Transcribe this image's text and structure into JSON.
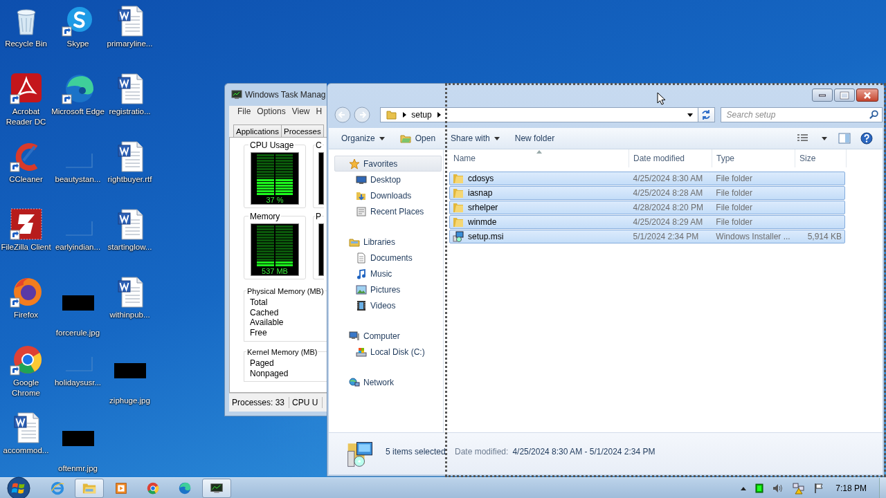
{
  "desktop": {
    "icons": [
      {
        "label": "Recycle Bin",
        "kind": "recycle",
        "shortcut": false
      },
      {
        "label": "Acrobat Reader DC",
        "kind": "acrobat",
        "shortcut": true
      },
      {
        "label": "CCleaner",
        "kind": "ccleaner",
        "shortcut": true
      },
      {
        "label": "FileZilla Client",
        "kind": "filezilla",
        "shortcut": true
      },
      {
        "label": "Firefox",
        "kind": "firefox",
        "shortcut": true
      },
      {
        "label": "Google Chrome",
        "kind": "chrome",
        "shortcut": true
      },
      {
        "label": "accommod...",
        "kind": "word",
        "shortcut": false
      },
      {
        "label": "Skype",
        "kind": "skype",
        "shortcut": true
      },
      {
        "label": "Microsoft Edge",
        "kind": "edge",
        "shortcut": true
      },
      {
        "label": "beautystan...",
        "kind": "blank",
        "shortcut": false
      },
      {
        "label": "earlyindian...",
        "kind": "blank",
        "shortcut": false
      },
      {
        "label": "forcerule.jpg",
        "kind": "jpg",
        "shortcut": false
      },
      {
        "label": "holidaysusr...",
        "kind": "blank",
        "shortcut": false
      },
      {
        "label": "oftenmr.jpg",
        "kind": "jpg",
        "shortcut": false
      },
      {
        "label": "primaryline...",
        "kind": "word",
        "shortcut": false
      },
      {
        "label": "registratio...",
        "kind": "word",
        "shortcut": false
      },
      {
        "label": "rightbuyer.rtf",
        "kind": "word",
        "shortcut": false
      },
      {
        "label": "startinglow...",
        "kind": "word",
        "shortcut": false
      },
      {
        "label": "withinpub...",
        "kind": "word",
        "shortcut": false
      },
      {
        "label": "ziphuge.jpg",
        "kind": "jpg",
        "shortcut": false
      }
    ]
  },
  "task_manager": {
    "title": "Windows Task Manag",
    "menu": [
      "File",
      "Options",
      "View",
      "H"
    ],
    "tabs": [
      {
        "label": "Applications",
        "selected": false
      },
      {
        "label": "Processes",
        "selected": false
      }
    ],
    "meters": [
      {
        "title": "CPU Usage",
        "reading": "37 %",
        "level": 0.37
      },
      {
        "title": "Memory",
        "reading": "537 MB",
        "level": 0.13
      }
    ],
    "history_titles": [
      "C",
      "P"
    ],
    "physical_memory": {
      "title": "Physical Memory (MB)",
      "rows": [
        "Total",
        "Cached",
        "Available",
        "Free"
      ]
    },
    "kernel_memory": {
      "title": "Kernel Memory (MB)",
      "rows": [
        "Paged",
        "Nonpaged"
      ]
    },
    "status_bar": [
      "Processes: 33",
      "CPU U"
    ]
  },
  "explorer": {
    "address": {
      "crumbs": [
        "setup"
      ]
    },
    "search": {
      "placeholder": "Search setup"
    },
    "toolbar": [
      {
        "label": "Organize",
        "kind": "menu"
      },
      {
        "label": "Open",
        "kind": "icon"
      },
      {
        "label": "Share with",
        "kind": "menu"
      },
      {
        "label": "New folder",
        "kind": "plain"
      }
    ],
    "nav": [
      {
        "label": "Favorites",
        "kind": "star",
        "selected": true,
        "children": [
          {
            "label": "Desktop",
            "kind": "desktop",
            "selected": false
          },
          {
            "label": "Downloads",
            "kind": "download",
            "selected": false
          },
          {
            "label": "Recent Places",
            "kind": "recent",
            "selected": false
          }
        ]
      },
      {
        "label": "Libraries",
        "kind": "library",
        "selected": false,
        "children": [
          {
            "label": "Documents",
            "kind": "document",
            "selected": false
          },
          {
            "label": "Music",
            "kind": "music",
            "selected": false
          },
          {
            "label": "Pictures",
            "kind": "pictures",
            "selected": false
          },
          {
            "label": "Videos",
            "kind": "video",
            "selected": false
          }
        ]
      },
      {
        "label": "Computer",
        "kind": "computer",
        "selected": false,
        "children": [
          {
            "label": "Local Disk (C:)",
            "kind": "disk",
            "selected": false
          }
        ]
      },
      {
        "label": "Network",
        "kind": "network",
        "selected": false
      }
    ],
    "columns": [
      {
        "label": "Name",
        "sorted": true
      },
      {
        "label": "Date modified",
        "sorted": false
      },
      {
        "label": "Type",
        "sorted": false
      },
      {
        "label": "Size",
        "sorted": false
      }
    ],
    "files": [
      {
        "name": "cdosys",
        "kind": "folder",
        "modified": "4/25/2024 8:30 AM",
        "type": "File folder",
        "selected": true
      },
      {
        "name": "iasnap",
        "kind": "folder",
        "modified": "4/25/2024 8:28 AM",
        "type": "File folder",
        "selected": true
      },
      {
        "name": "srhelper",
        "kind": "folder",
        "modified": "4/28/2024 8:20 PM",
        "type": "File folder",
        "selected": true
      },
      {
        "name": "winmde",
        "kind": "folder",
        "modified": "4/25/2024 8:29 AM",
        "type": "File folder",
        "selected": true
      },
      {
        "name": "setup.msi",
        "kind": "installer",
        "modified": "5/1/2024 2:34 PM",
        "type": "Windows Installer ...",
        "size": "5,914 KB",
        "selected": true
      }
    ],
    "details": {
      "summary": "5 items selected",
      "label": "Date modified:",
      "value": "4/25/2024 8:30 AM - 5/1/2024 2:34 PM"
    }
  },
  "taskbar": {
    "apps": [
      {
        "kind": "ie",
        "open": false
      },
      {
        "kind": "explorer",
        "open": true
      },
      {
        "kind": "media",
        "open": false
      },
      {
        "kind": "chrome",
        "open": false
      },
      {
        "kind": "edge",
        "open": false
      },
      {
        "kind": "taskmgr",
        "open": true
      }
    ],
    "clock": "7:18 PM"
  }
}
